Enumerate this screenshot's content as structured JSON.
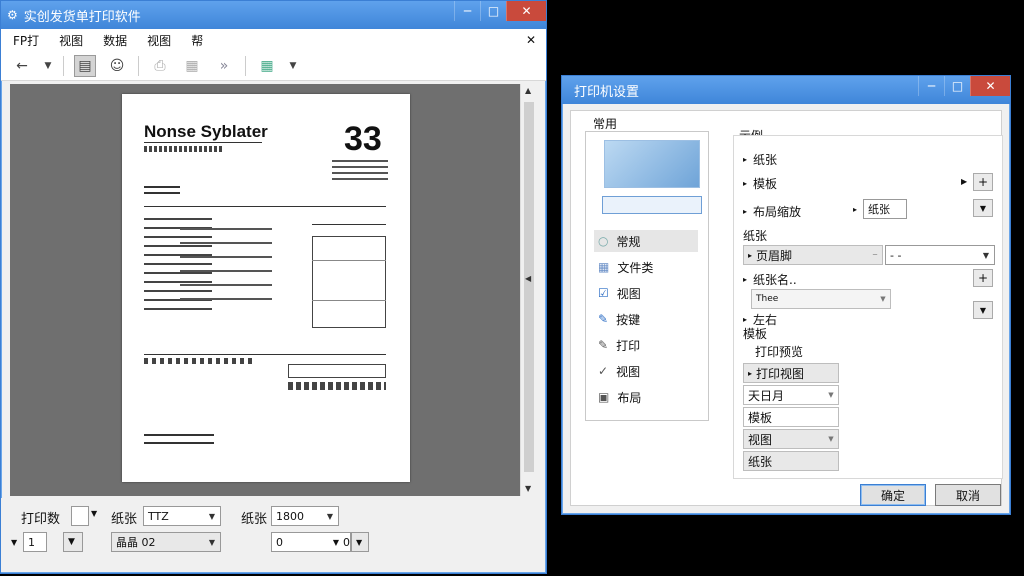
{
  "main_window": {
    "title": "实创发货单打印软件",
    "menu": [
      "FP打",
      "视图",
      "数据",
      "视图",
      "帮"
    ],
    "document": {
      "title": "Nonse Syblater",
      "number": "33"
    },
    "bottom": {
      "print_copies_label": "打印数",
      "copies_value": "1",
      "paper_label": "纸张",
      "paper_value": "TTZ",
      "paper2_label": "纸张",
      "paper2_value": "1800",
      "combo2_value": "晶晶 02",
      "combo3_value": "0",
      "combo3_value2": "0"
    }
  },
  "settings_window": {
    "title": "打印机设置",
    "left_group_label": "常用",
    "nav_items": [
      {
        "label": "常规",
        "icon": "circle-icon"
      },
      {
        "label": "文件类",
        "icon": "file-icon"
      },
      {
        "label": "视图",
        "icon": "check-icon"
      },
      {
        "label": "按键",
        "icon": "pen-icon"
      },
      {
        "label": "打印",
        "icon": "pen-icon"
      },
      {
        "label": "视图",
        "icon": "check-icon"
      },
      {
        "label": "布局",
        "icon": "layout-icon"
      }
    ],
    "group1_label": "示例",
    "group1_rows": [
      "纸张",
      "模板",
      "布局缩放"
    ],
    "dropdown_value": "纸张",
    "group2_label": "纸张",
    "group2_rows": [
      "页眉脚",
      "纸张名..",
      "Thee",
      "左右"
    ],
    "combo_right": "- -",
    "group3_label": "模板",
    "group3_sub": "打印预览",
    "group3_items": [
      "打印视图",
      "天日月",
      "模板",
      "视图",
      "纸张"
    ],
    "ok_label": "确定",
    "cancel_label": "取消"
  }
}
